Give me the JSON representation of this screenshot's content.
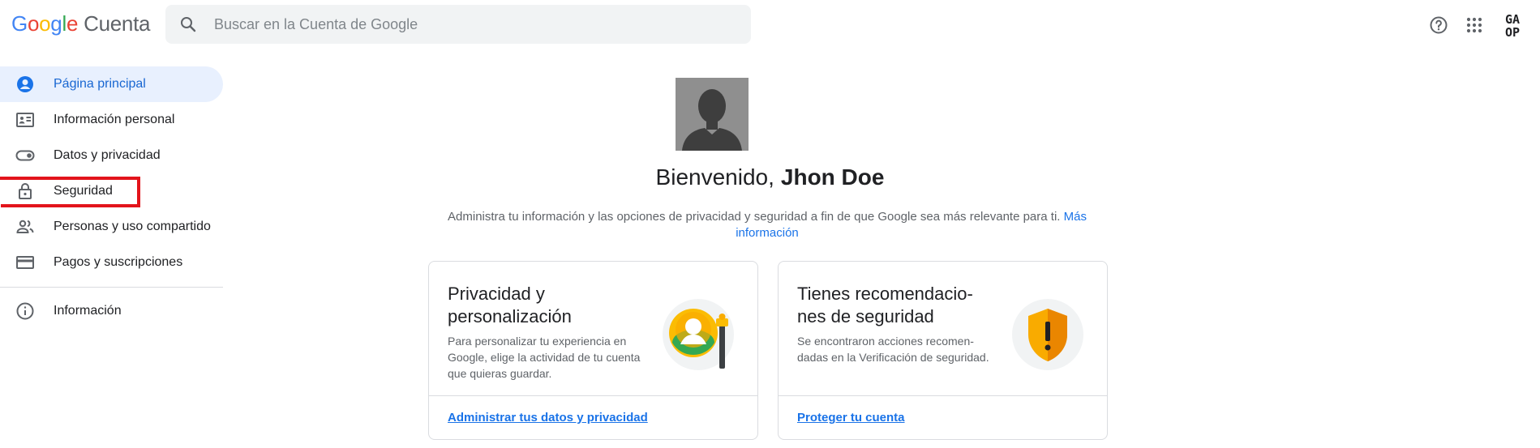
{
  "header": {
    "logo_letters": [
      "G",
      "o",
      "o",
      "g",
      "l",
      "e"
    ],
    "product_name": "Cuenta",
    "search_placeholder": "Buscar en la Cuenta de Google",
    "icons": [
      "help-icon",
      "apps-icon",
      "account-avatar"
    ],
    "avatar_text_top": "GA",
    "avatar_text_bottom": "OP"
  },
  "sidebar": {
    "items": [
      {
        "label": "Página principal",
        "icon": "home-icon",
        "active": true
      },
      {
        "label": "Información personal",
        "icon": "id-card-icon"
      },
      {
        "label": "Datos y privacidad",
        "icon": "toggle-icon"
      },
      {
        "label": "Seguridad",
        "icon": "lock-icon",
        "highlighted": true
      },
      {
        "label": "Personas y uso compartido",
        "icon": "people-icon"
      },
      {
        "label": "Pagos y suscripciones",
        "icon": "credit-card-icon"
      }
    ],
    "footer_items": [
      {
        "label": "Información",
        "icon": "info-icon"
      }
    ],
    "highlight_color": "#e3141b"
  },
  "main": {
    "welcome_greeting": "Bienvenido,",
    "user_name": "Jhon Doe",
    "description": "Administra tu información y las opciones de privacidad y seguridad a fin de que Google sea más relevante para ti.",
    "learn_more": "Más información",
    "cards": [
      {
        "title": "Privacidad y personalización",
        "description": "Para personalizar tu experiencia en Google, elige la actividad de tu cuenta que quieras guardar.",
        "link": "Administrar tus datos y privacidad",
        "icon": "privacy-illustration-icon"
      },
      {
        "title": "Tienes recomendacio-nes de seguridad",
        "description": "Se encontraron acciones recomen-dadas en la Verificación de seguridad.",
        "link": "Proteger tu cuenta",
        "icon": "security-shield-warning-icon"
      }
    ]
  },
  "colors": {
    "accent": "#1a73e8",
    "active_nav_bg": "#e8f0fe",
    "shield": "#f9ab00"
  }
}
